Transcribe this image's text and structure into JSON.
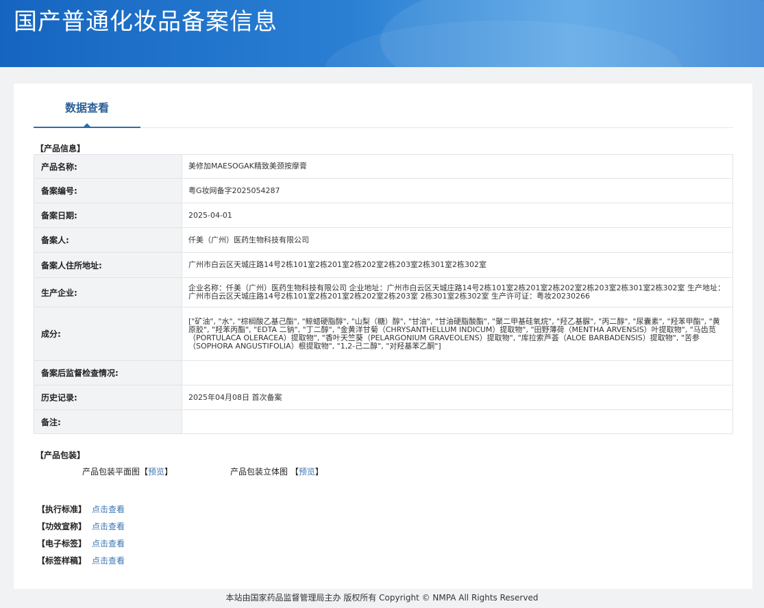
{
  "header": {
    "title": "国产普通化妆品备案信息"
  },
  "tabs": [
    {
      "label": "数据查看"
    }
  ],
  "product_info": {
    "section_title": "【产品信息】",
    "rows": [
      {
        "label": "产品名称:",
        "value": "美修加MAESOGAK精致美颈按摩膏"
      },
      {
        "label": "备案编号:",
        "value": "粤G妆网备字2025054287"
      },
      {
        "label": "备案日期:",
        "value": "2025-04-01"
      },
      {
        "label": "备案人:",
        "value": "仟美（广州）医药生物科技有限公司"
      },
      {
        "label": "备案人住所地址:",
        "value": "广州市白云区天城庄路14号2栋101室2栋201室2栋202室2栋203室2栋301室2栋302室"
      },
      {
        "label": "生产企业:",
        "value": "企业名称：仟美（广州）医药生物科技有限公司 企业地址：广州市白云区天城庄路14号2栋101室2栋201室2栋202室2栋203室2栋301室2栋302室 生产地址：广州市白云区天城庄路14号2栋101室2栋201室2栋202室2栋203室 2栋301室2栋302室 生产许可证：粤妆20230266"
      },
      {
        "label": "成分:",
        "value": "[\"矿油\", \"水\", \"棕榈酸乙基己酯\", \"鲸蜡硬脂醇\", \"山梨（糖）醇\", \"甘油\", \"甘油硬脂酸酯\", \"聚二甲基硅氧烷\", \"羟乙基脲\", \"丙二醇\", \"尿囊素\", \"羟苯甲酯\", \"黄原胶\", \"羟苯丙酯\", \"EDTA 二钠\", \"丁二醇\", \"金黄洋甘菊（CHRYSANTHELLUM INDICUM）提取物\", \"田野薄荷（MENTHA ARVENSIS）叶提取物\", \"马齿苋（PORTULACA OLERACEA）提取物\", \"香叶天竺葵（PELARGONIUM GRAVEOLENS）提取物\", \"库拉索芦荟（ALOE BARBADENSIS）提取物\", \"苦参（SOPHORA ANGUSTIFOLIA）根提取物\", \"1,2-己二醇\", \"对羟基苯乙酮\"]"
      },
      {
        "label": "备案后监督检查情况:",
        "value": ""
      },
      {
        "label": "历史记录:",
        "value": "2025年04月08日 首次备案"
      },
      {
        "label": "备注:",
        "value": ""
      }
    ]
  },
  "packaging": {
    "section_title": "【产品包装】",
    "items": [
      {
        "label": "产品包装平面图",
        "bracket_open": "【",
        "link": "预览",
        "bracket_close": "】"
      },
      {
        "label": "产品包装立体图",
        "bracket_open": "【",
        "link": "预览",
        "bracket_close": "】"
      }
    ]
  },
  "standards": [
    {
      "label": "【执行标准】",
      "link": "点击查看"
    },
    {
      "label": "【功效宣称】",
      "link": "点击查看"
    },
    {
      "label": "【电子标签】",
      "link": "点击查看"
    },
    {
      "label": "【标签样稿】",
      "link": "点击查看"
    }
  ],
  "footer": {
    "text": "本站由国家药品监督管理局主办 版权所有 Copyright © NMPA All Rights Reserved"
  },
  "colors": {
    "header_blue": "#1565c0",
    "tab_blue": "#2b6cae",
    "link_blue": "#3a76b0"
  }
}
